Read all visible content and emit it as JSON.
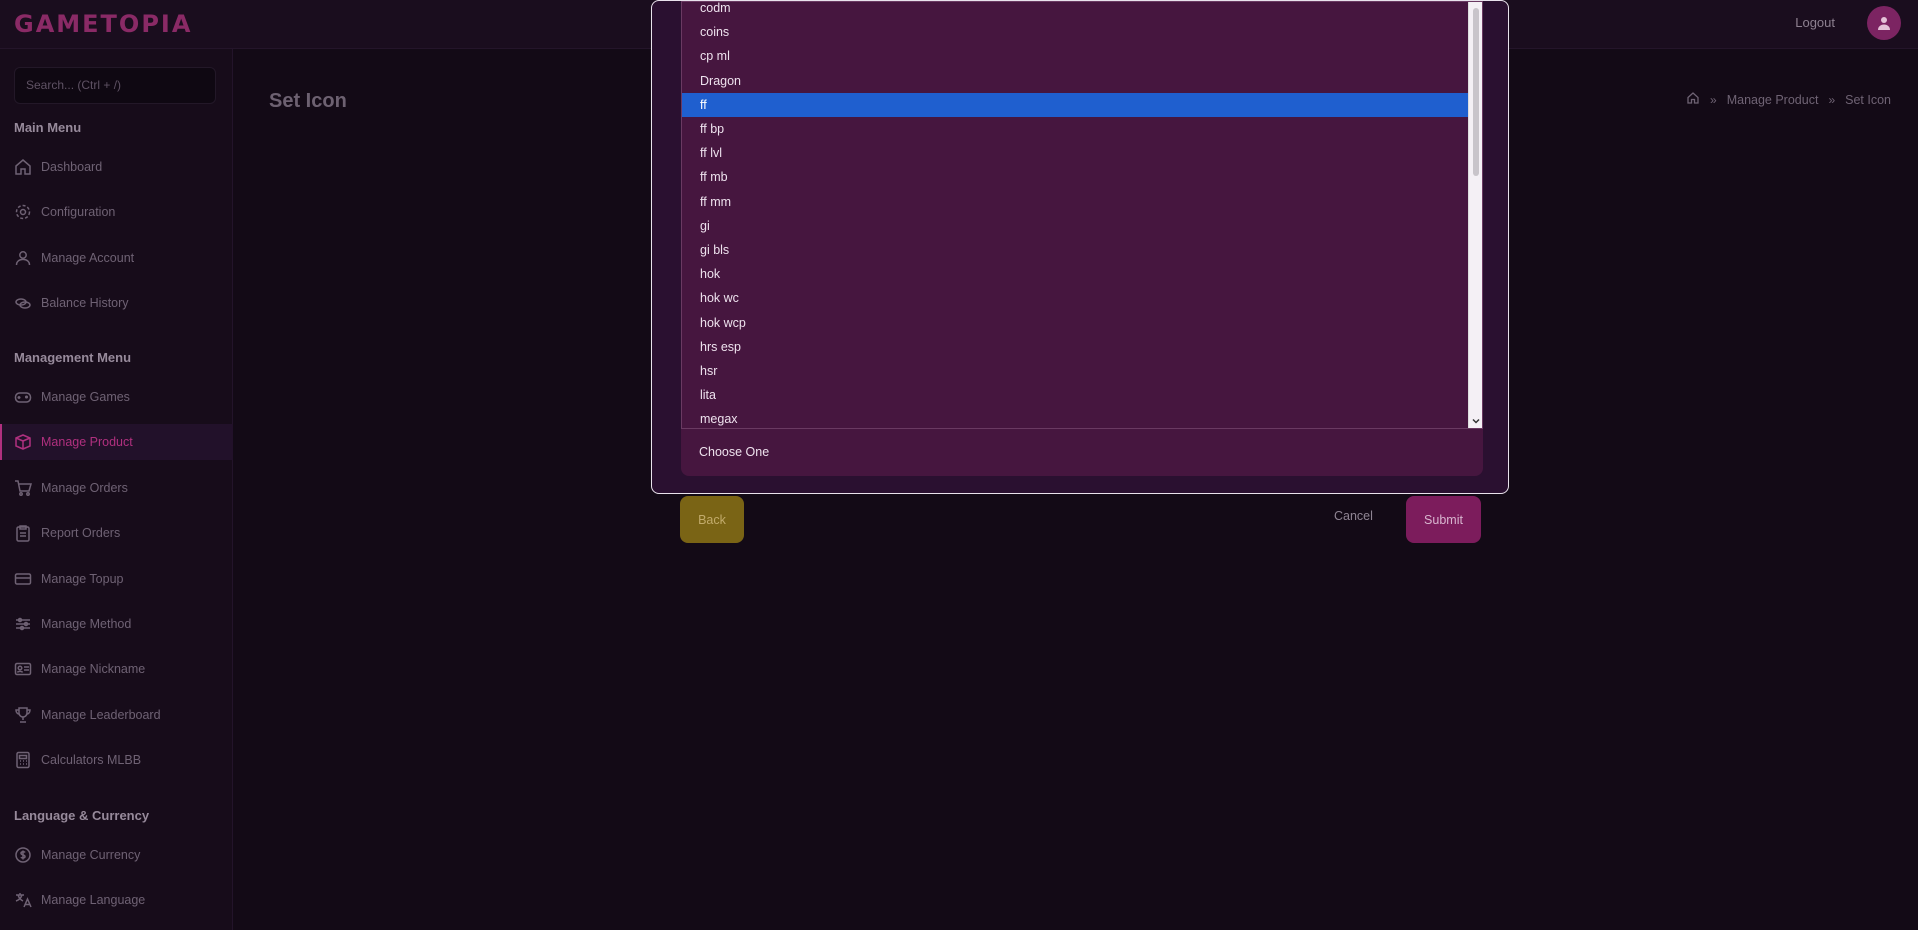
{
  "brand": {
    "logo_text": "GAMETOPIA",
    "accent": "#b0307f"
  },
  "header": {
    "logout_label": "Logout",
    "avatar_icon": "user-icon"
  },
  "sidebar": {
    "search_placeholder": "Search... (Ctrl + /)",
    "main_menu_title": "Main Menu",
    "main_menu": [
      {
        "label": "Dashboard",
        "icon": "home-icon"
      },
      {
        "label": "Configuration",
        "icon": "gear-icon"
      },
      {
        "label": "Manage Account",
        "icon": "user-icon"
      },
      {
        "label": "Balance History",
        "icon": "coins-icon"
      }
    ],
    "management_menu_title": "Management Menu",
    "management_menu": [
      {
        "label": "Manage Games",
        "icon": "gamepad-icon"
      },
      {
        "label": "Manage Product",
        "icon": "box-icon",
        "active": true
      },
      {
        "label": "Manage Orders",
        "icon": "cart-icon"
      },
      {
        "label": "Report Orders",
        "icon": "clipboard-icon"
      },
      {
        "label": "Manage Topup",
        "icon": "card-icon"
      },
      {
        "label": "Manage Method",
        "icon": "sliders-icon"
      },
      {
        "label": "Manage Nickname",
        "icon": "id-card-icon"
      },
      {
        "label": "Manage Leaderboard",
        "icon": "trophy-icon"
      },
      {
        "label": "Calculators MLBB",
        "icon": "calculator-icon"
      }
    ],
    "lang_menu_title": "Language & Currency",
    "lang_menu": [
      {
        "label": "Manage Currency",
        "icon": "dollar-icon"
      },
      {
        "label": "Manage Language",
        "icon": "translate-icon"
      }
    ]
  },
  "main": {
    "page_title": "Set Icon",
    "breadcrumb": [
      "Manage Product",
      "Set Icon"
    ]
  },
  "modal": {
    "options": [
      "codm",
      "coins",
      "cp ml",
      "Dragon",
      "ff",
      "ff bp",
      "ff lvl",
      "ff mb",
      "ff mm",
      "gi",
      "gi bls",
      "hok",
      "hok wc",
      "hok wcp",
      "hrs esp",
      "hsr",
      "lita",
      "megax"
    ],
    "selected": "ff",
    "choose_label": "Choose One",
    "back_label": "Back",
    "cancel_label": "Cancel",
    "submit_label": "Submit"
  }
}
